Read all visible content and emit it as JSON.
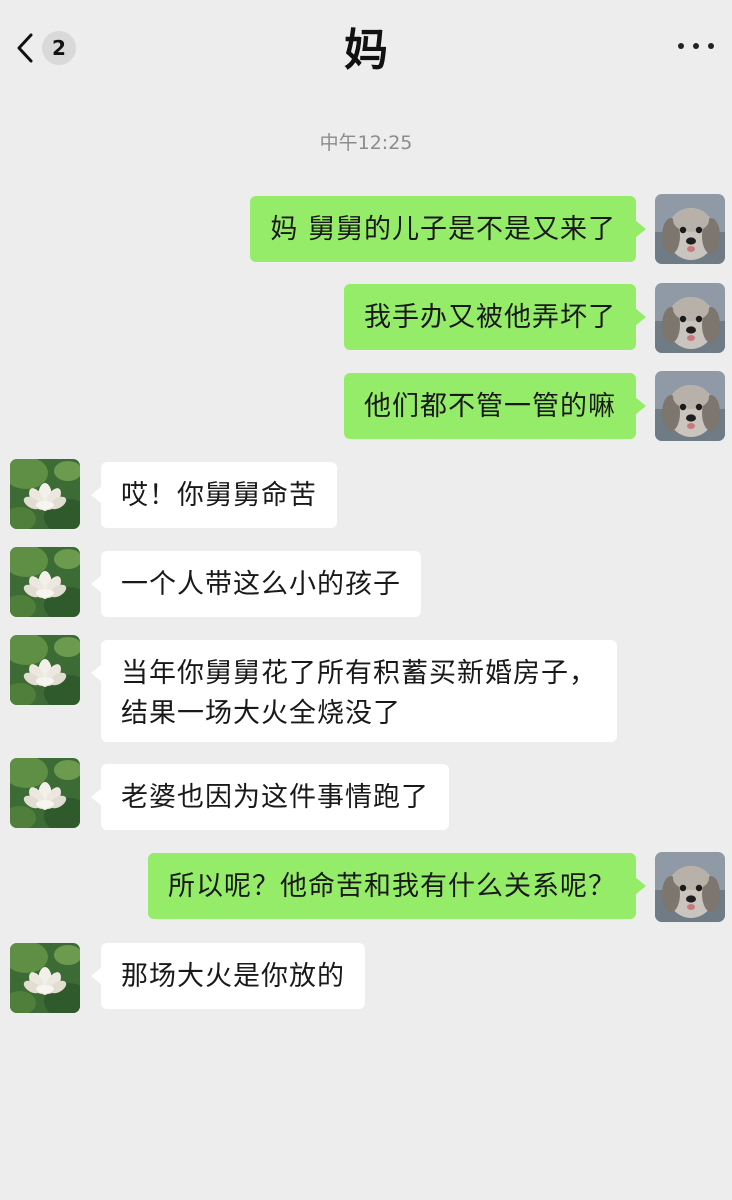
{
  "header": {
    "back_count": "2",
    "title": "妈"
  },
  "chat": {
    "timestamp": "中午12:25",
    "messages": [
      {
        "sender": "me",
        "lines": [
          "妈 舅舅的儿子是不是又来了"
        ]
      },
      {
        "sender": "me",
        "lines": [
          "我手办又被他弄坏了"
        ]
      },
      {
        "sender": "me",
        "lines": [
          "他们都不管一管的嘛"
        ]
      },
      {
        "sender": "other",
        "lines": [
          "哎！你舅舅命苦"
        ]
      },
      {
        "sender": "other",
        "lines": [
          "一个人带这么小的孩子"
        ]
      },
      {
        "sender": "other",
        "lines": [
          "当年你舅舅花了所有积蓄买新婚房子，",
          "结果一场大火全烧没了"
        ]
      },
      {
        "sender": "other",
        "lines": [
          "老婆也因为这件事情跑了"
        ]
      },
      {
        "sender": "me",
        "lines": [
          "所以呢？他命苦和我有什么关系呢？"
        ]
      },
      {
        "sender": "other",
        "lines": [
          "那场大火是你放的"
        ]
      }
    ]
  },
  "colors": {
    "background": "#ededed",
    "my_bubble": "#95ec69",
    "other_bubble": "#ffffff",
    "timestamp": "#8c8c8c"
  },
  "icons": {
    "back": "chevron-left-icon",
    "more": "more-dots-icon",
    "my_avatar": "dog-avatar",
    "contact_avatar": "lotus-avatar"
  }
}
